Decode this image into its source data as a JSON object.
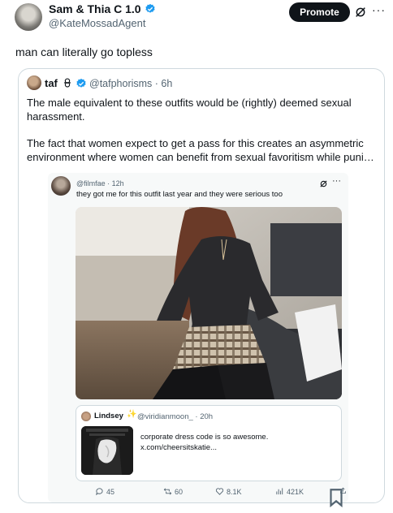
{
  "tweet": {
    "author_name": "Sam & Thia C 1.0",
    "author_handle": "@KateMossadAgent",
    "promote_label": "Promote",
    "more_label": "···",
    "text": "man can literally go topless"
  },
  "quote": {
    "author_name": "taf",
    "author_handle": "@tafphorisms · 6h",
    "paragraph1": "The male equivalent to these outfits would be (rightly) deemed sexual harassment.",
    "paragraph2_line1": "The fact that women expect to get a pass for this creates an asymmetric",
    "paragraph2_line2": "environment where women can benefit from sexual favoritism while punishin..."
  },
  "inner": {
    "author_handle": "@filmfae · 12h",
    "text": "they got me for this outfit last year and they were serious too",
    "more_label": "···"
  },
  "nested": {
    "author_name": "Lindsey",
    "sparkle": "✨",
    "author_handle": "@viridianmoon_ · 20h",
    "text_line1": "corporate dress code is so awesome.",
    "text_line2": "x.com/cheersitskatie..."
  },
  "actions": {
    "replies": "45",
    "reposts": "60",
    "likes": "8.1K",
    "views": "421K"
  },
  "colors": {
    "verified": "#1d9bf0",
    "promote_bg": "#0f1419",
    "secondary_text": "#536471",
    "border": "#cfd9de"
  }
}
